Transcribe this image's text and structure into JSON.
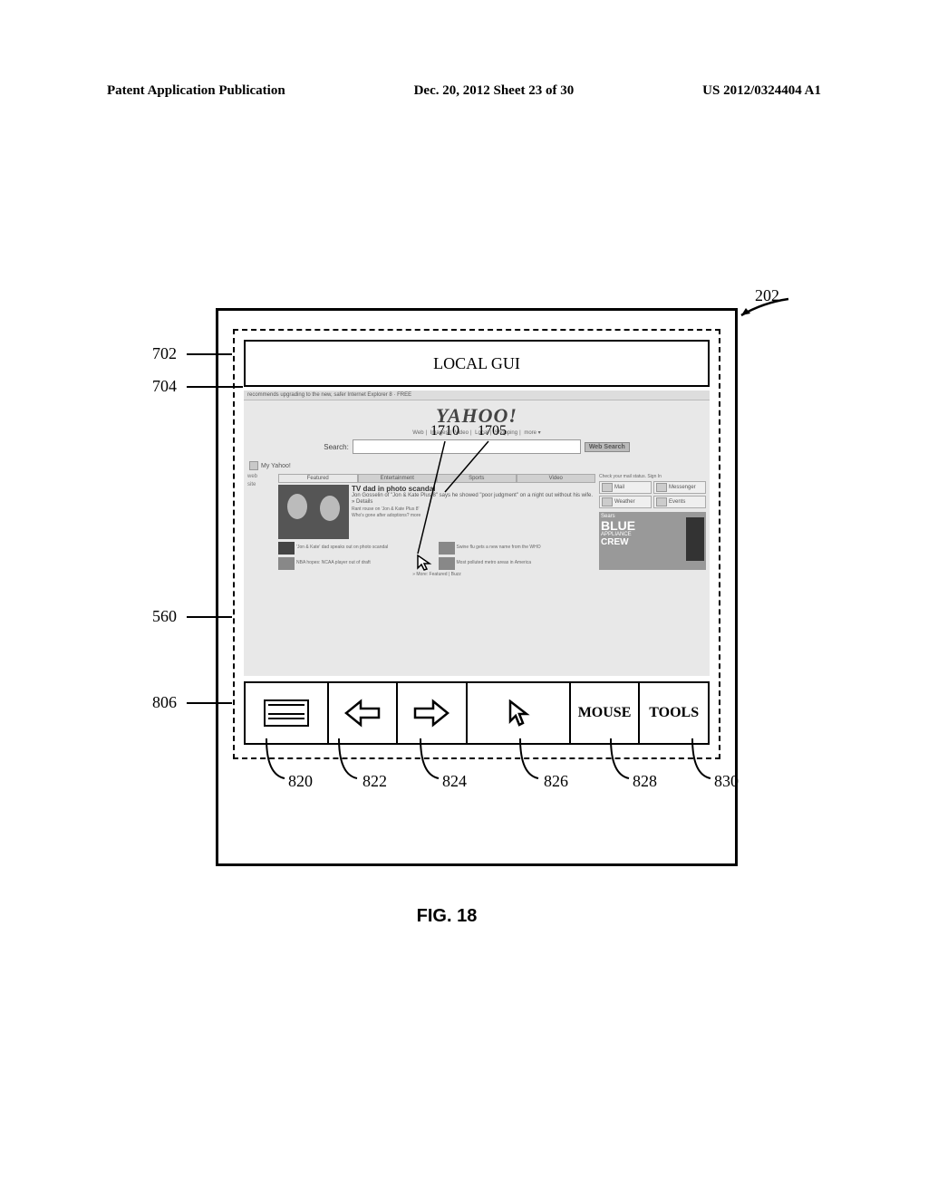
{
  "header": {
    "left": "Patent Application Publication",
    "center": "Dec. 20, 2012  Sheet 23 of 30",
    "right": "US 2012/0324404 A1"
  },
  "figure": {
    "caption": "FIG. 18",
    "local_gui_label": "LOCAL GUI",
    "refs": {
      "r202": "202",
      "r702": "702",
      "r704": "704",
      "r560": "560",
      "r806": "806",
      "r820": "820",
      "r822": "822",
      "r824": "824",
      "r826": "826",
      "r828": "828",
      "r830": "830",
      "r1705": "1705",
      "r1710": "1710"
    },
    "toolbar": {
      "mouse_label": "MOUSE",
      "tools_label": "TOOLS"
    }
  },
  "remote": {
    "upgrade_bar": "recommends upgrading to the new, safer Internet Explorer 8 · FREE",
    "logo": "YAHOO!",
    "nav": [
      "Web",
      "Images",
      "Video",
      "Local",
      "Shopping",
      "more ▾"
    ],
    "search_label": "Search:",
    "search_button": "Web Search",
    "my_label": "My Yahoo!",
    "left_items": [
      "web",
      "site"
    ],
    "tabs": [
      "Featured",
      "Entertainment",
      "Sports",
      "Video"
    ],
    "story": {
      "title": "TV dad in photo scandal",
      "body": "Jon Gosselin of \"Jon & Kate Plus 8\" says he showed \"poor judgment\" on a night out without his wife.  » Details",
      "links": [
        "Rant rouse on 'Jon & Kate Plus 8'",
        "Who's gone after adoptions? more"
      ]
    },
    "thumbs": [
      {
        "a": "'Jon & Kate' dad speaks out on photo scandal"
      },
      {
        "a": "Swine flu gets a new name from the WHO"
      },
      {
        "a": "NBA hopes: NCAA player out of draft"
      },
      {
        "a": "Most polluted metro areas in America"
      }
    ],
    "footer_strip": "» More: Featured | Buzz",
    "mail_status": "Check your mail status. Sign In",
    "tiles": [
      [
        "Mail",
        "Messenger"
      ],
      [
        "Weather",
        "Events"
      ]
    ],
    "ad": {
      "brand": "Sears",
      "big": "BLUE",
      "sub": "APPLIANCE",
      "crew": "CREW"
    }
  }
}
